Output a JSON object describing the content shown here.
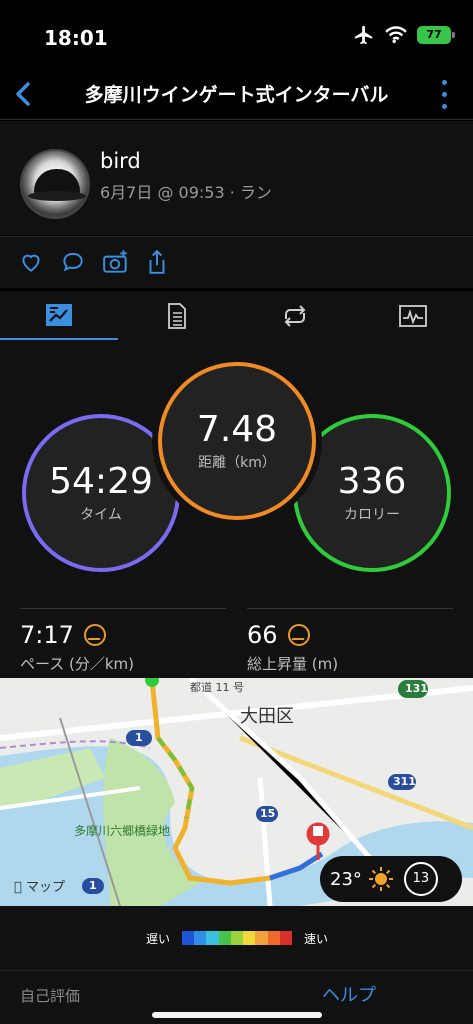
{
  "status_bar": {
    "time": "18:01",
    "battery": "77",
    "icons": [
      "airplane-icon",
      "wifi-icon",
      "battery-icon"
    ]
  },
  "nav": {
    "title": "多摩川ウインゲート式インターバル",
    "back_icon": "chevron-left-icon",
    "more_icon": "more-vertical-icon"
  },
  "activity": {
    "user_name": "bird",
    "meta": "6月7日 @ 09:53 · ラン"
  },
  "actions": [
    "heart-icon",
    "comment-icon",
    "add-photo-icon",
    "share-icon"
  ],
  "tabs": [
    "summary-tab-icon",
    "details-tab-icon",
    "laps-tab-icon",
    "chart-tab-icon"
  ],
  "rings": {
    "time": {
      "value": "54:29",
      "label": "タイム",
      "color": "#7a6cf0"
    },
    "distance": {
      "value": "7.48",
      "label": "距離（km）",
      "color": "#f08a24"
    },
    "calories": {
      "value": "336",
      "label": "カロリー",
      "color": "#2ecc3a"
    }
  },
  "metrics": {
    "pace": {
      "value": "7:17",
      "label": "ペース (分／km)"
    },
    "elevation": {
      "value": "66",
      "label": "総上昇量 (m)"
    }
  },
  "map": {
    "labels": {
      "district": "大田区",
      "road": "都道 11 号",
      "park": "多摩川六郷橋緑地",
      "apple_maps": "マップ"
    },
    "shields": [
      "1",
      "15",
      "131",
      "311",
      "1"
    ],
    "weather": {
      "temp": "23°",
      "wind": "13"
    }
  },
  "legend": {
    "slow": "遅い",
    "fast": "速い",
    "colors": [
      "#1d55d6",
      "#2f8fe8",
      "#3cc0e0",
      "#47c24a",
      "#9bd23a",
      "#f2d83a",
      "#f2a23a",
      "#ee6a2a",
      "#d8302a"
    ]
  },
  "footer": {
    "self_eval": "自己評価",
    "help": "ヘルプ"
  }
}
